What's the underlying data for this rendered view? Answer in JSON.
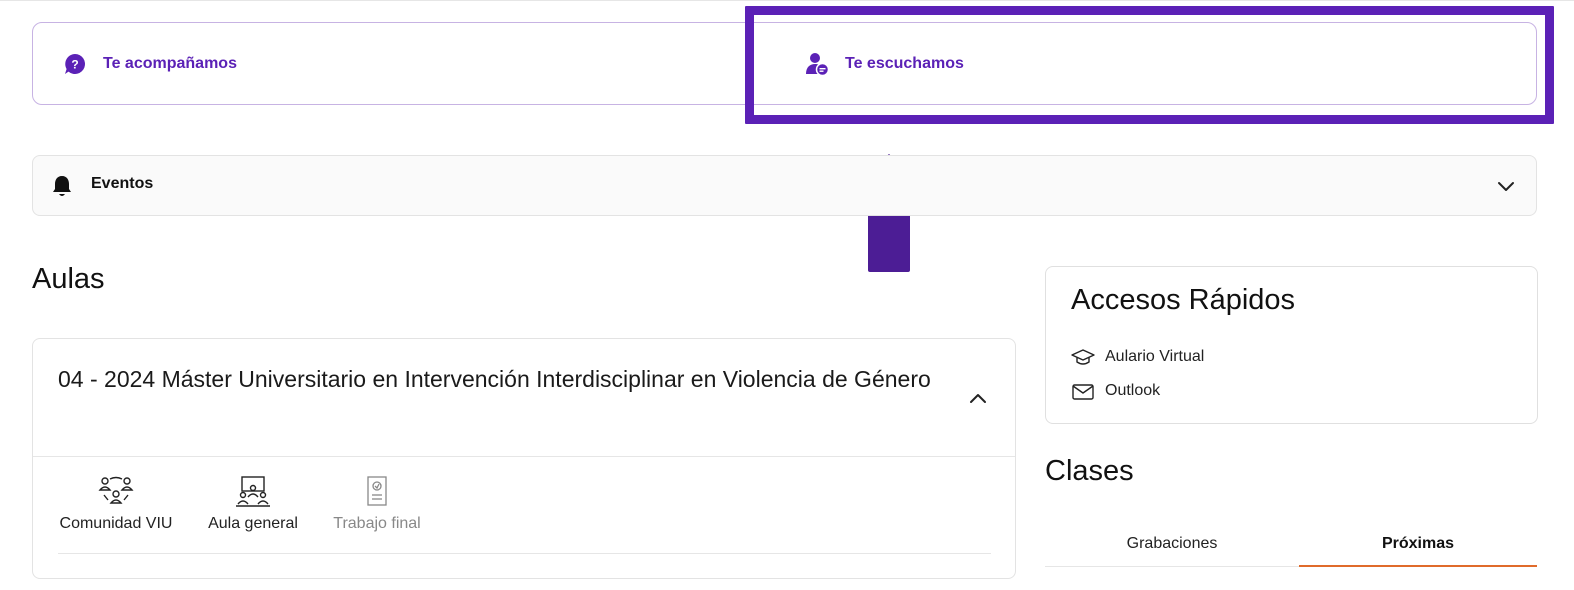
{
  "support": {
    "accompany_label": "Te acompañamos",
    "listen_label": "Te escuchamos",
    "accent_color": "#5b21b6"
  },
  "events": {
    "label": "Eventos",
    "state": "collapsed"
  },
  "aulas": {
    "title": "Aulas",
    "course": {
      "title": "04 - 2024 Máster Universitario en Intervención Interdisciplinar en Violencia de Género",
      "state": "expanded",
      "tools": [
        {
          "label": "Comunidad VIU",
          "icon": "community-icon",
          "enabled": true
        },
        {
          "label": "Aula general",
          "icon": "classroom-icon",
          "enabled": true
        },
        {
          "label": "Trabajo final",
          "icon": "certificate-icon",
          "enabled": false
        }
      ]
    }
  },
  "quick_access": {
    "title": "Accesos Rápidos",
    "links": [
      {
        "label": "Aulario Virtual",
        "icon": "graduation-cap-icon"
      },
      {
        "label": "Outlook",
        "icon": "mail-icon"
      }
    ]
  },
  "clases": {
    "title": "Clases",
    "tabs": [
      {
        "label": "Grabaciones",
        "active": false
      },
      {
        "label": "Próximas",
        "active": true
      }
    ],
    "tab_accent_color": "#e06b2b"
  }
}
